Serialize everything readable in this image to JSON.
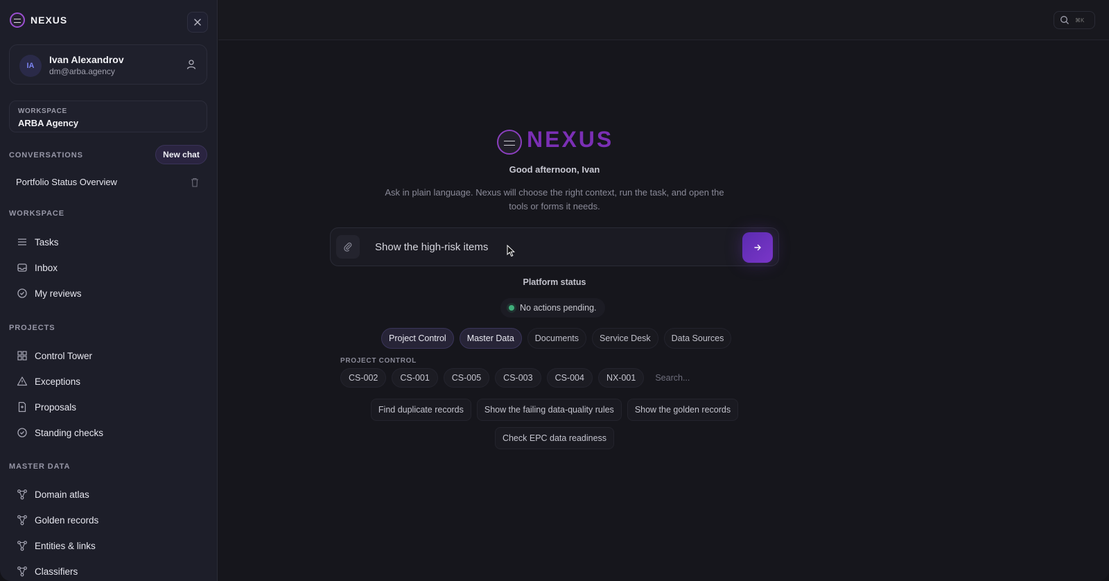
{
  "brand": {
    "name": "NEXUS"
  },
  "user": {
    "initials": "IA",
    "name": "Ivan Alexandrov",
    "email": "dm@arba.agency"
  },
  "workspace_card": {
    "label": "WORKSPACE",
    "name": "ARBA Agency"
  },
  "conversations": {
    "label": "CONVERSATIONS",
    "new_chat": "New chat",
    "items": [
      {
        "title": "Portfolio Status Overview"
      }
    ]
  },
  "workspace_nav": {
    "label": "WORKSPACE",
    "items": [
      {
        "label": "Tasks",
        "icon": "list-icon"
      },
      {
        "label": "Inbox",
        "icon": "inbox-icon"
      },
      {
        "label": "My reviews",
        "icon": "check-circle-icon"
      }
    ]
  },
  "projects_nav": {
    "label": "PROJECTS",
    "items": [
      {
        "label": "Control Tower",
        "icon": "grid-icon"
      },
      {
        "label": "Exceptions",
        "icon": "warning-icon"
      },
      {
        "label": "Proposals",
        "icon": "document-icon"
      },
      {
        "label": "Standing checks",
        "icon": "check-circle-icon"
      }
    ]
  },
  "master_data_nav": {
    "label": "MASTER DATA",
    "items": [
      {
        "label": "Domain atlas",
        "icon": "graph-icon"
      },
      {
        "label": "Golden records",
        "icon": "graph-icon"
      },
      {
        "label": "Entities & links",
        "icon": "graph-icon"
      },
      {
        "label": "Classifiers",
        "icon": "graph-icon"
      }
    ]
  },
  "topbar": {
    "shortcut": "⌘K"
  },
  "hero": {
    "title": "NEXUS",
    "greeting": "Good afternoon, Ivan",
    "subtitle": "Ask in plain language. Nexus will choose the right context, run the task, and open the tools or forms it needs."
  },
  "prompt": {
    "value": "Show the high-risk items"
  },
  "platform_status": {
    "title": "Platform status",
    "message": "No actions pending."
  },
  "tabs": [
    {
      "label": "Project Control",
      "active": true
    },
    {
      "label": "Master Data",
      "active": true
    },
    {
      "label": "Documents",
      "active": false
    },
    {
      "label": "Service Desk",
      "active": false
    },
    {
      "label": "Data Sources",
      "active": false
    }
  ],
  "project_control": {
    "label": "PROJECT CONTROL",
    "projects": [
      "CS-002",
      "CS-001",
      "CS-005",
      "CS-003",
      "CS-004",
      "NX-001"
    ],
    "search_placeholder": "Search..."
  },
  "suggestions": [
    "Find duplicate records",
    "Show the failing data-quality rules",
    "Show the golden records",
    "Check EPC data readiness"
  ],
  "colors": {
    "accent": "#7b2fb5",
    "status_ok": "#3fae7a",
    "sidebar_bg": "#1d1e29",
    "main_bg": "#16161c"
  }
}
